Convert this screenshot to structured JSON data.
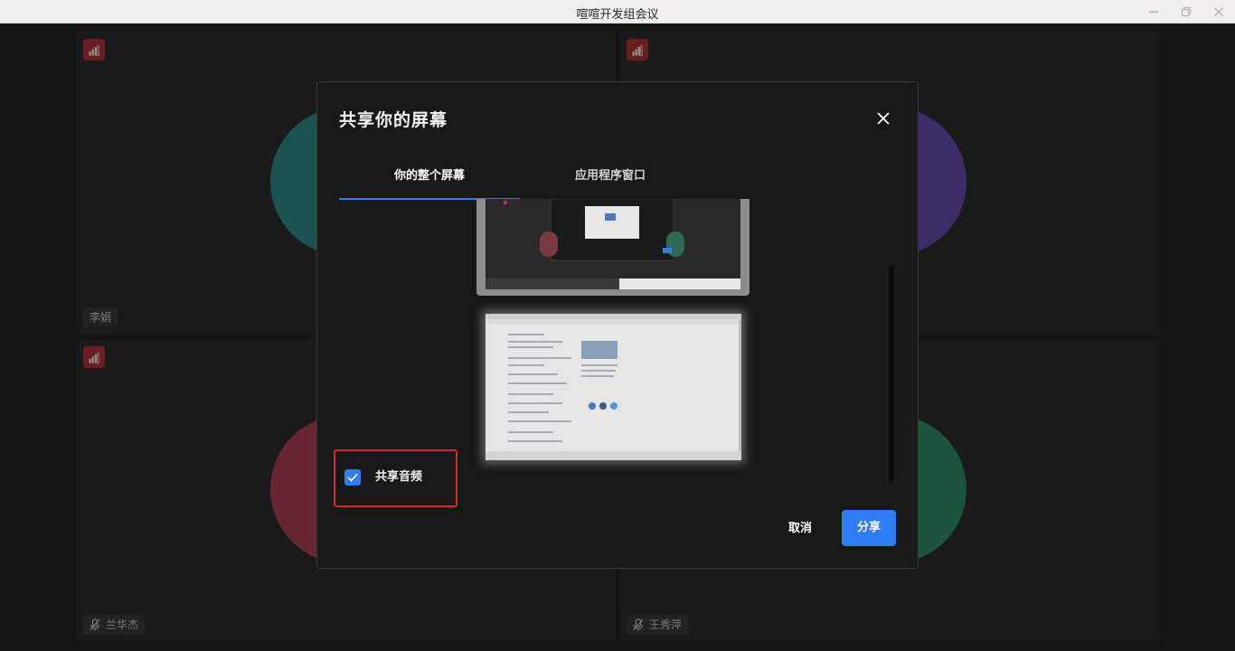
{
  "window": {
    "title": "喧喧开发组会议",
    "minimize_icon": "minimize-icon",
    "restore_icon": "restore-icon",
    "close_icon": "close-icon"
  },
  "participants": [
    {
      "name": "李娟",
      "avatar_color": "#2f8f8c",
      "muted": false
    },
    {
      "name": "",
      "avatar_color": "#6a4fb0",
      "muted": false
    },
    {
      "name": "兰华杰",
      "avatar_color": "#b04455",
      "muted": true
    },
    {
      "name": "王秀萍",
      "avatar_color": "#2f8f6a",
      "muted": true
    }
  ],
  "dialog": {
    "title": "共享你的屏幕",
    "close_icon": "close-icon",
    "tabs": [
      {
        "label": "你的整个屏幕",
        "active": true
      },
      {
        "label": "应用程序窗口",
        "active": false
      }
    ],
    "share_audio": {
      "label": "共享音频",
      "checked": true
    },
    "cancel_label": "取消",
    "share_label": "分享"
  },
  "colors": {
    "accent": "#2f7cf6",
    "highlight_border": "#e0271f",
    "signal_badge": "#b8333a"
  }
}
